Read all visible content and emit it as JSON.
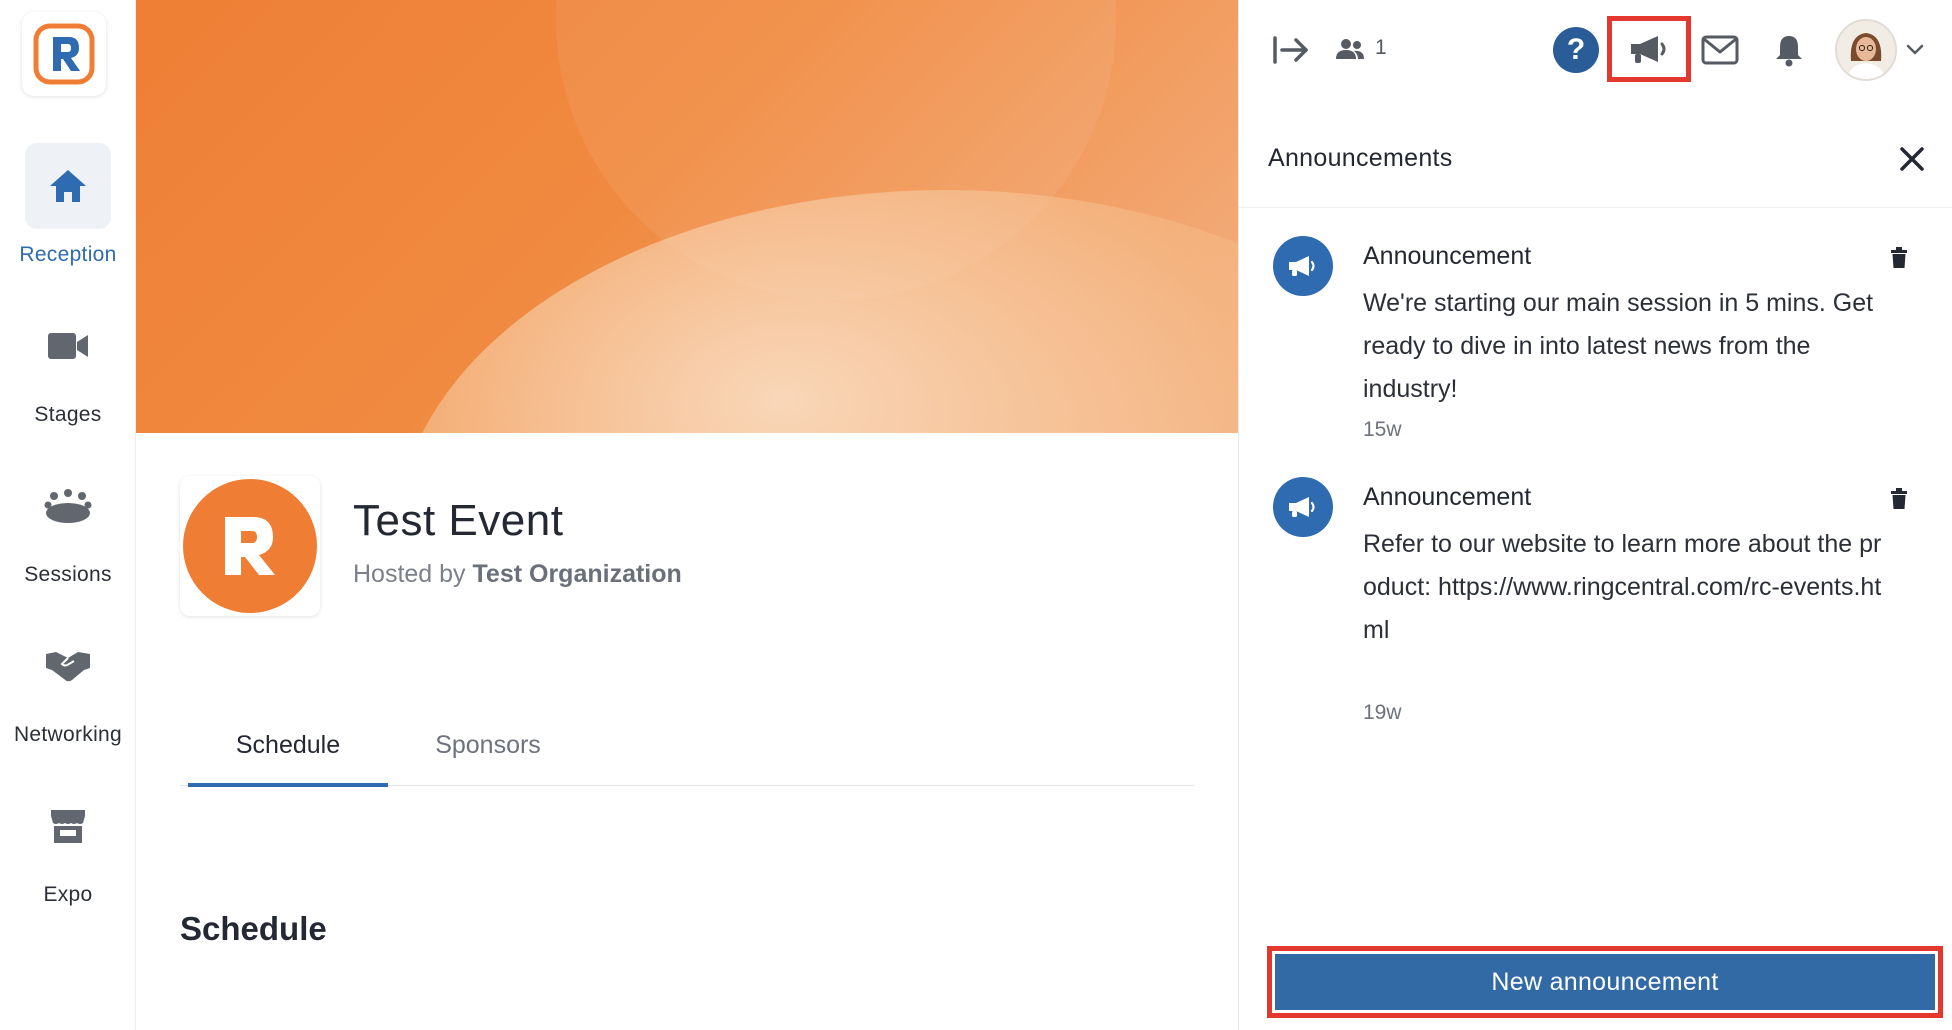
{
  "sidebar": {
    "items": [
      {
        "label": "Reception",
        "icon": "home-icon",
        "active": true
      },
      {
        "label": "Stages",
        "icon": "video-camera-icon",
        "active": false
      },
      {
        "label": "Sessions",
        "icon": "group-icon",
        "active": false
      },
      {
        "label": "Networking",
        "icon": "handshake-icon",
        "active": false
      },
      {
        "label": "Expo",
        "icon": "booth-icon",
        "active": false
      }
    ]
  },
  "event": {
    "title": "Test Event",
    "hosted_by_prefix": "Hosted by",
    "organization": "Test Organization"
  },
  "tabs": [
    {
      "label": "Schedule",
      "active": true
    },
    {
      "label": "Sponsors",
      "active": false
    }
  ],
  "section": {
    "title": "Schedule"
  },
  "topbar": {
    "attendee_count": "1",
    "help_label": "?"
  },
  "panel": {
    "title": "Announcements",
    "announcements": [
      {
        "title": "Announcement",
        "body": "We're starting our main session in 5 mins. Get ready to dive in into latest news from the industry!",
        "time": "15w"
      },
      {
        "title": "Announcement",
        "body": "Refer to our website to learn more about the product: https://www.ringcentral.com/rc-events.html",
        "time": "19w"
      }
    ],
    "new_button_label": "New announcement"
  },
  "colors": {
    "accent": "#2e6bb0",
    "brand_orange": "#ef7d33",
    "highlight": "#e4372d"
  }
}
